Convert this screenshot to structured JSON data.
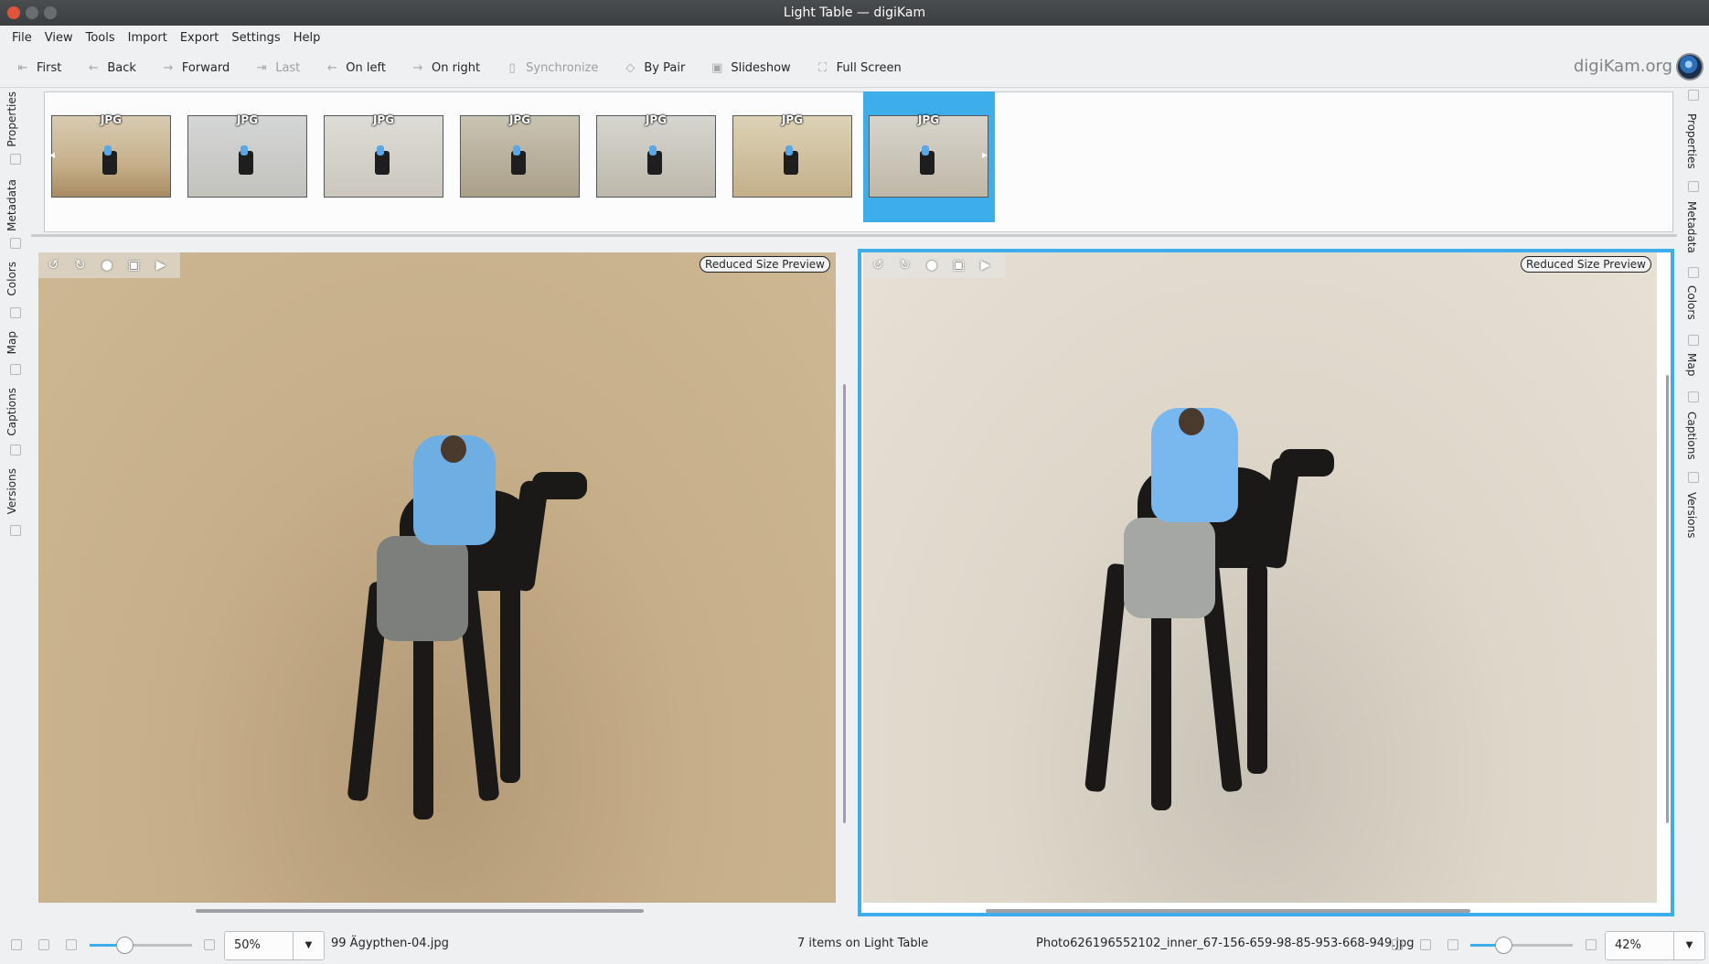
{
  "window": {
    "title": "Light Table — digiKam"
  },
  "menu": [
    "File",
    "View",
    "Tools",
    "Import",
    "Export",
    "Settings",
    "Help"
  ],
  "toolbar": {
    "first": "First",
    "back": "Back",
    "forward": "Forward",
    "last": "Last",
    "on_left": "On left",
    "on_right": "On right",
    "synchronize": "Synchronize",
    "by_pair": "By Pair",
    "slideshow": "Slideshow",
    "full_screen": "Full Screen",
    "brand": "digiKam.org"
  },
  "left_sidebar": [
    "Properties",
    "Metadata",
    "Colors",
    "Map",
    "Captions",
    "Versions"
  ],
  "right_sidebar": [
    "Properties",
    "Metadata",
    "Colors",
    "Map",
    "Captions",
    "Versions"
  ],
  "thumbnails": [
    {
      "badge": "JPG"
    },
    {
      "badge": "JPG"
    },
    {
      "badge": "JPG"
    },
    {
      "badge": "JPG"
    },
    {
      "badge": "JPG"
    },
    {
      "badge": "JPG"
    },
    {
      "badge": "JPG",
      "selected": true
    }
  ],
  "panes": {
    "left_badge": "Reduced Size Preview",
    "right_badge": "Reduced Size Preview"
  },
  "status": {
    "left_zoom": "50%",
    "left_file": "99 Ägypthen-04.jpg",
    "count": "7 items on Light Table",
    "right_file": "Photo626196552102_inner_67-156-659-98-85-953-668-949.jpg",
    "right_zoom": "42%",
    "left_slider_level": 0.35,
    "right_slider_level": 0.33
  },
  "colors": {
    "accent": "#3daee9"
  }
}
